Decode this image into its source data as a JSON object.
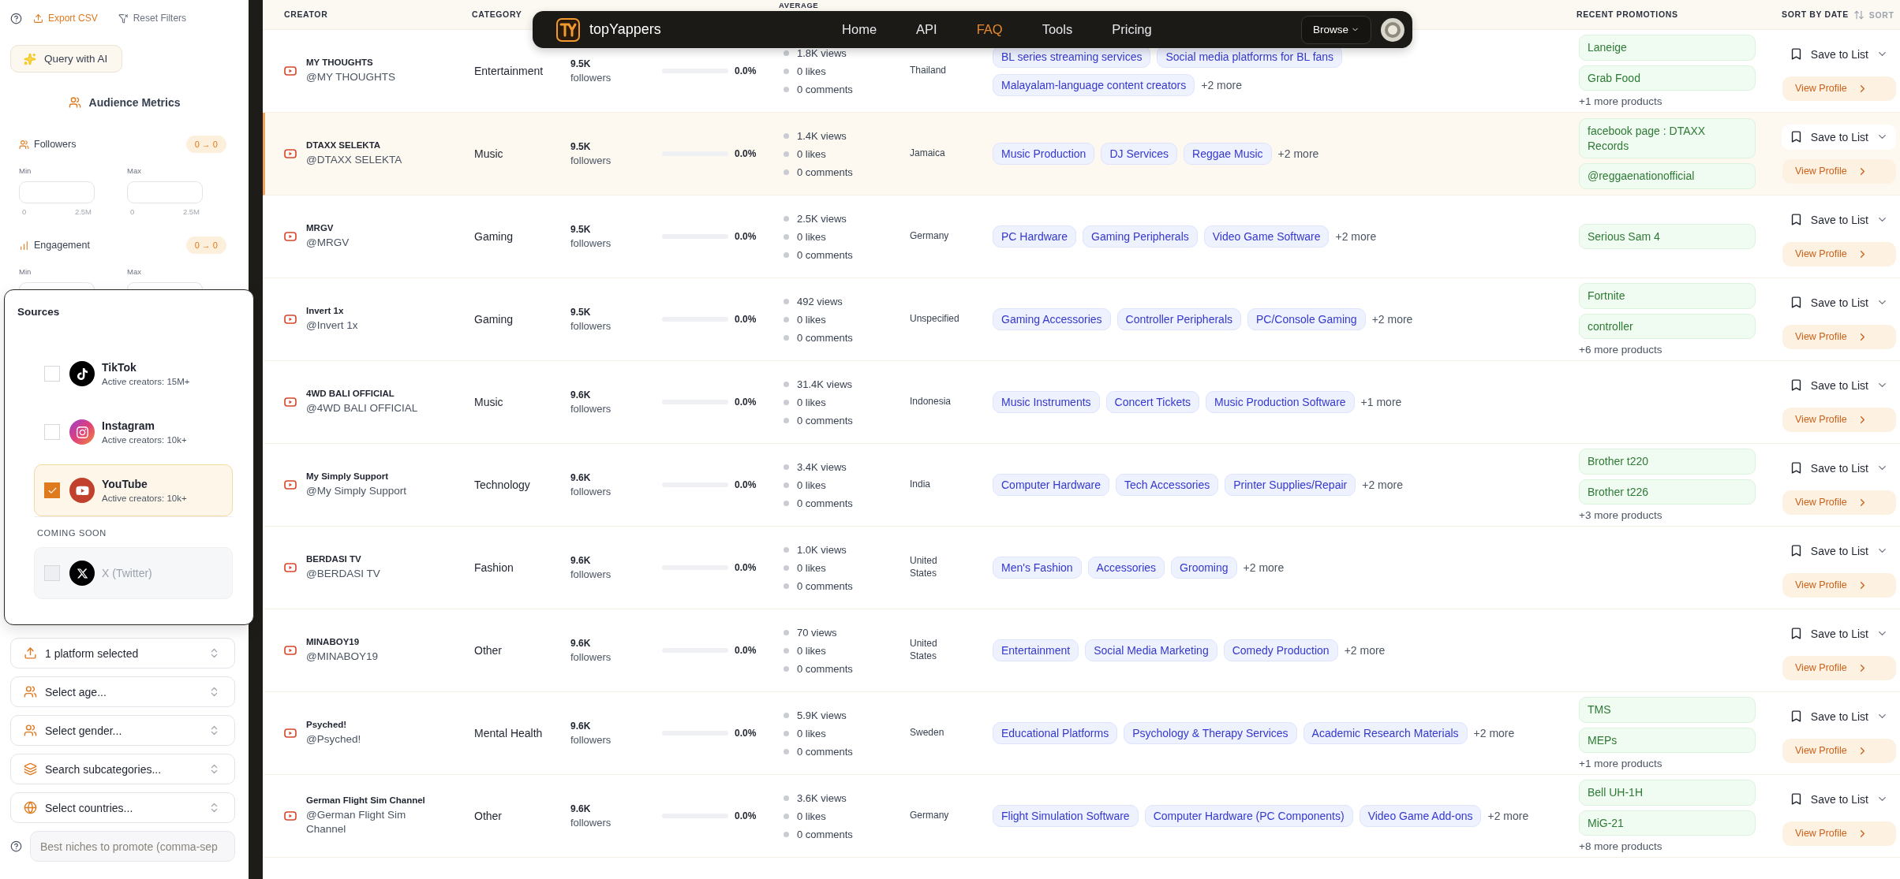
{
  "sidebar": {
    "export_label": "Export CSV",
    "reset_label": "Reset Filters",
    "ai_button": "Query with AI",
    "section_title": "Audience Metrics",
    "metrics": [
      {
        "kind": "people",
        "label": "Followers",
        "range": "0 → 0",
        "min_label": "Min",
        "max_label": "Max",
        "min_scale": [
          "0",
          "2.5M"
        ],
        "max_scale": [
          "0",
          "2.5M"
        ]
      },
      {
        "kind": "bars",
        "label": "Engagement",
        "range": "0 → 0",
        "min_label": "Min",
        "max_label": "Max"
      }
    ],
    "selects": [
      {
        "kind": "platform",
        "label": "1 platform selected"
      },
      {
        "kind": "age",
        "label": "Select age..."
      },
      {
        "kind": "gender",
        "label": "Select gender..."
      },
      {
        "kind": "subcategory",
        "label": "Search subcategories..."
      },
      {
        "kind": "country",
        "label": "Select countries..."
      }
    ],
    "niches": {
      "placeholder": "Best niches to promote (comma-sep"
    }
  },
  "sources_popup": {
    "title": "Sources",
    "options": [
      {
        "kind": "tiktok",
        "name": "TikTok",
        "subtitle": "Active creators: 15M+",
        "checked": false
      },
      {
        "kind": "instagram",
        "name": "Instagram",
        "subtitle": "Active creators: 10k+",
        "checked": false
      },
      {
        "kind": "youtube",
        "name": "YouTube",
        "subtitle": "Active creators: 10k+",
        "checked": true
      }
    ],
    "coming_soon_label": "COMING SOON",
    "coming_soon": [
      {
        "kind": "x",
        "name": "X (Twitter)",
        "checked": false,
        "disabled": true
      }
    ]
  },
  "nav": {
    "brand": "topYappers",
    "links": [
      {
        "label": "Home",
        "selected": false
      },
      {
        "label": "API",
        "selected": false
      },
      {
        "label": "FAQ",
        "selected": true
      },
      {
        "label": "Tools",
        "selected": false
      },
      {
        "label": "Pricing",
        "selected": false
      }
    ],
    "browse": "Browse"
  },
  "table": {
    "header": {
      "creator": "CREATOR",
      "category": "CATEGORY",
      "average": "AVERAGE",
      "promotions": "RECENT PROMOTIONS",
      "sort_by": "SORT BY DATE",
      "sort": "SORT"
    },
    "rows": [
      {
        "selected": false,
        "name": "MY THOUGHTS",
        "save_label": "Save to List",
        "view_label": "View Profile",
        "handle": "@MY THOUGHTS",
        "category": "Entertainment",
        "followers": "9.5K",
        "followers_label": "followers",
        "level": 0,
        "rate": "0.0%",
        "stats": [
          "1.8K views",
          "0 likes",
          "0 comments"
        ],
        "country": "Thailand",
        "tags": [
          "BL series streaming services",
          "Social media platforms for BL fans",
          "Malayalam-language content creators"
        ],
        "more_tags": "+2 more",
        "promotions": [
          "Laneige",
          "Grab Food"
        ],
        "more_promotions": "+1 more products"
      },
      {
        "selected": true,
        "name": "DTAXX SELEKTA",
        "save_label": "Save to List",
        "view_label": "View Profile",
        "handle": "@DTAXX SELEKTA",
        "category": "Music",
        "followers": "9.5K",
        "followers_label": "followers",
        "level": 0,
        "rate": "0.0%",
        "stats": [
          "1.4K views",
          "0 likes",
          "0 comments"
        ],
        "country": "Jamaica",
        "tags": [
          "Music Production",
          "DJ Services",
          "Reggae Music"
        ],
        "more_tags": "+2 more",
        "promotions": [
          "facebook page : DTAXX Records",
          "@reggaenationofficial"
        ]
      },
      {
        "selected": false,
        "name": "MRGV",
        "save_label": "Save to List",
        "view_label": "View Profile",
        "handle": "@MRGV",
        "category": "Gaming",
        "followers": "9.5K",
        "followers_label": "followers",
        "level": 0,
        "rate": "0.0%",
        "stats": [
          "2.5K views",
          "0 likes",
          "0 comments"
        ],
        "country": "Germany",
        "tags": [
          "PC Hardware",
          "Gaming Peripherals",
          "Video Game Software"
        ],
        "more_tags": "+2 more",
        "promotions": [
          "Serious Sam 4"
        ]
      },
      {
        "selected": false,
        "name": "Invert 1x",
        "save_label": "Save to List",
        "view_label": "View Profile",
        "handle": "@Invert 1x",
        "category": "Gaming",
        "followers": "9.5K",
        "followers_label": "followers",
        "level": 0,
        "rate": "0.0%",
        "stats": [
          "492 views",
          "0 likes",
          "0 comments"
        ],
        "country": "Unspecified",
        "tags": [
          "Gaming Accessories",
          "Controller Peripherals",
          "PC/Console Gaming"
        ],
        "more_tags": "+2 more",
        "promotions": [
          "Fortnite",
          "controller"
        ],
        "more_promotions": "+6 more products"
      },
      {
        "selected": false,
        "name": "4WD BALI OFFICIAL",
        "save_label": "Save to List",
        "view_label": "View Profile",
        "handle": "@4WD BALI OFFICIAL",
        "category": "Music",
        "followers": "9.6K",
        "followers_label": "followers",
        "level": 0,
        "rate": "0.0%",
        "stats": [
          "31.4K views",
          "0 likes",
          "0 comments"
        ],
        "country": "Indonesia",
        "tags": [
          "Music Instruments",
          "Concert Tickets",
          "Music Production Software"
        ],
        "more_tags": "+1 more"
      },
      {
        "selected": false,
        "name": "My Simply Support",
        "save_label": "Save to List",
        "view_label": "View Profile",
        "handle": "@My Simply Support",
        "category": "Technology",
        "followers": "9.6K",
        "followers_label": "followers",
        "level": 0,
        "rate": "0.0%",
        "stats": [
          "3.4K views",
          "0 likes",
          "0 comments"
        ],
        "country": "India",
        "tags": [
          "Computer Hardware",
          "Tech Accessories",
          "Printer Supplies/Repair"
        ],
        "more_tags": "+2 more",
        "promotions": [
          "Brother t220",
          "Brother t226"
        ],
        "more_promotions": "+3 more products"
      },
      {
        "selected": false,
        "name": "BERDASI TV",
        "save_label": "Save to List",
        "view_label": "View Profile",
        "handle": "@BERDASI TV",
        "category": "Fashion",
        "followers": "9.6K",
        "followers_label": "followers",
        "level": 0,
        "rate": "0.0%",
        "stats": [
          "1.0K views",
          "0 likes",
          "0 comments"
        ],
        "country": "United States",
        "tags": [
          "Men's Fashion",
          "Accessories",
          "Grooming"
        ],
        "more_tags": "+2 more"
      },
      {
        "selected": false,
        "name": "MINABOY19",
        "save_label": "Save to List",
        "view_label": "View Profile",
        "handle": "@MINABOY19",
        "category": "Other",
        "followers": "9.6K",
        "followers_label": "followers",
        "level": 0,
        "rate": "0.0%",
        "stats": [
          "70 views",
          "0 likes",
          "0 comments"
        ],
        "country": "United States",
        "tags": [
          "Entertainment",
          "Social Media Marketing",
          "Comedy Production"
        ],
        "more_tags": "+2 more"
      },
      {
        "selected": false,
        "name": "Psyched!",
        "save_label": "Save to List",
        "view_label": "View Profile",
        "handle": "@Psyched!",
        "category": "Mental Health",
        "followers": "9.6K",
        "followers_label": "followers",
        "level": 0,
        "rate": "0.0%",
        "stats": [
          "5.9K views",
          "0 likes",
          "0 comments"
        ],
        "country": "Sweden",
        "tags": [
          "Educational Platforms",
          "Psychology & Therapy Services",
          "Academic Research Materials"
        ],
        "more_tags": "+2 more",
        "promotions": [
          "TMS",
          "MEPs"
        ],
        "more_promotions": "+1 more products"
      },
      {
        "selected": false,
        "name": "German Flight Sim Channel",
        "save_label": "Save to List",
        "view_label": "View Profile",
        "handle": "@German Flight Sim Channel",
        "category": "Other",
        "followers": "9.6K",
        "followers_label": "followers",
        "level": 0,
        "rate": "0.0%",
        "stats": [
          "3.6K views",
          "0 likes",
          "0 comments"
        ],
        "country": "Germany",
        "tags": [
          "Flight Simulation Software",
          "Computer Hardware (PC Components)",
          "Video Game Add-ons"
        ],
        "more_tags": "+2 more",
        "promotions": [
          "Bell UH-1H",
          "MiG-21"
        ],
        "more_promotions": "+8 more products"
      }
    ]
  }
}
